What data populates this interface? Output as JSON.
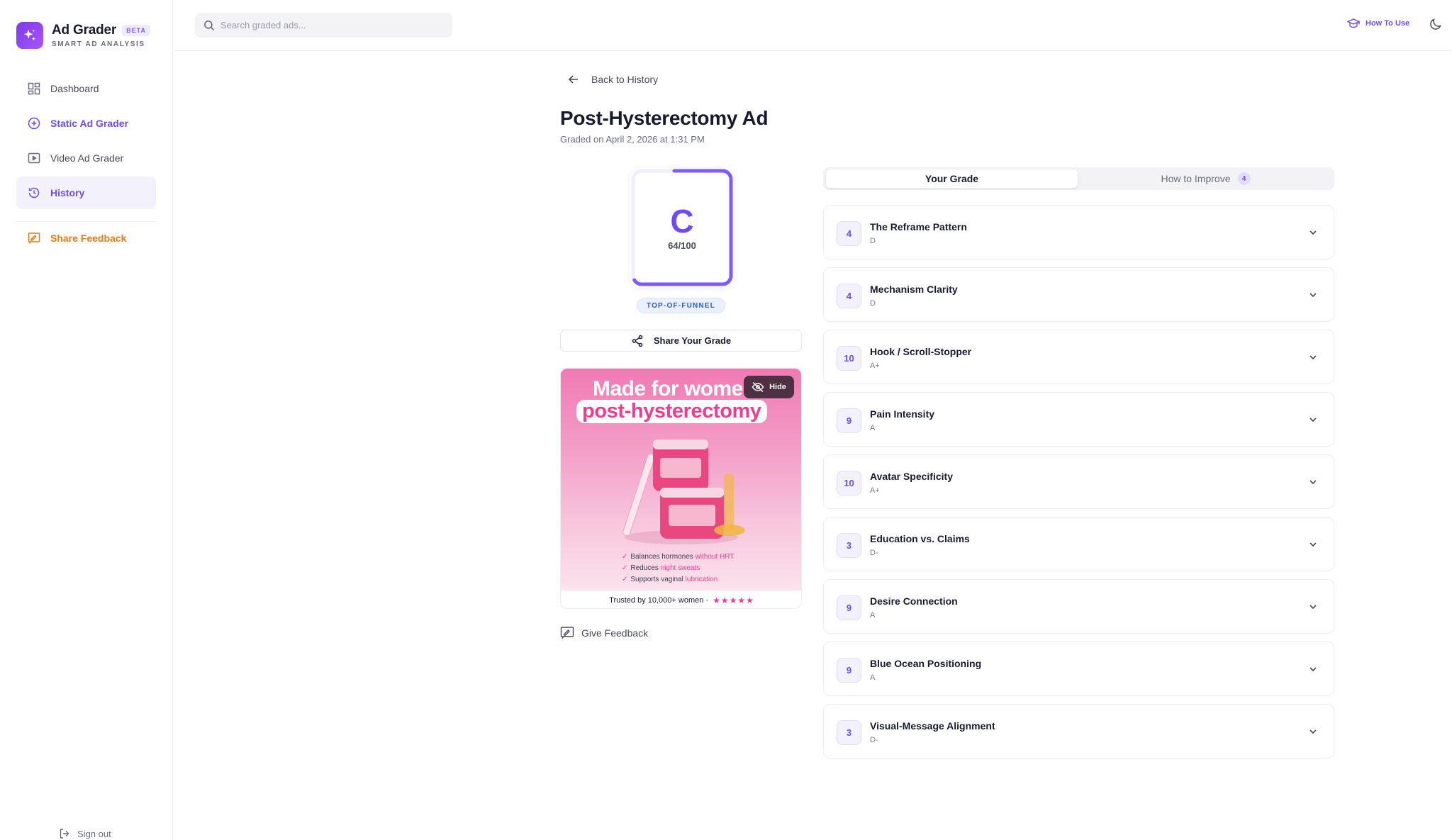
{
  "brand": {
    "name": "Ad Grader",
    "badge": "BETA",
    "tagline": "SMART AD ANALYSIS"
  },
  "search": {
    "placeholder": "Search graded ads..."
  },
  "topbar": {
    "how_to_use": "How To Use"
  },
  "sidebar": {
    "items": [
      {
        "label": "Dashboard",
        "icon": "grid-icon"
      },
      {
        "label": "Static Ad Grader",
        "icon": "plus-circle-icon"
      },
      {
        "label": "Video Ad Grader",
        "icon": "play-square-icon"
      },
      {
        "label": "History",
        "icon": "history-icon"
      }
    ],
    "feedback": "Share Feedback",
    "sign_out": "Sign out"
  },
  "page": {
    "back_label": "Back to History",
    "title": "Post-Hysterectomy Ad",
    "subtitle": "Graded on April 2, 2026 at 1:31 PM"
  },
  "grade": {
    "letter": "C",
    "score": "64/100",
    "score_value": 64,
    "funnel": "TOP-OF-FUNNEL"
  },
  "share_label": "Share Your Grade",
  "ad": {
    "headline_1": "Made for wome",
    "headline_2": "post-hysterectomy",
    "hide_label": "Hide",
    "bullets": [
      {
        "pre": "Balances hormones ",
        "hl": "without HRT"
      },
      {
        "pre": "Reduces ",
        "hl": "night sweats"
      },
      {
        "pre": "Supports vaginal ",
        "hl": "lubrication"
      }
    ],
    "footer": "Trusted by 10,000+ women ·",
    "stars": "★★★★★"
  },
  "give_feedback": "Give Feedback",
  "tabs": {
    "grade": "Your Grade",
    "improve": "How to Improve",
    "improve_count": "4"
  },
  "criteria": [
    {
      "score": "4",
      "name": "The Reframe Pattern",
      "letter": "D"
    },
    {
      "score": "4",
      "name": "Mechanism Clarity",
      "letter": "D"
    },
    {
      "score": "10",
      "name": "Hook / Scroll-Stopper",
      "letter": "A+"
    },
    {
      "score": "9",
      "name": "Pain Intensity",
      "letter": "A"
    },
    {
      "score": "10",
      "name": "Avatar Specificity",
      "letter": "A+"
    },
    {
      "score": "3",
      "name": "Education vs. Claims",
      "letter": "D-"
    },
    {
      "score": "9",
      "name": "Desire Connection",
      "letter": "A"
    },
    {
      "score": "9",
      "name": "Blue Ocean Positioning",
      "letter": "A"
    },
    {
      "score": "3",
      "name": "Visual-Message Alignment",
      "letter": "D-"
    }
  ],
  "colors": {
    "accent": "#6d4aff",
    "feedback": "#ea7a10",
    "funnel": "#2a5bd8",
    "ad_pink": "#ec3d8f"
  }
}
